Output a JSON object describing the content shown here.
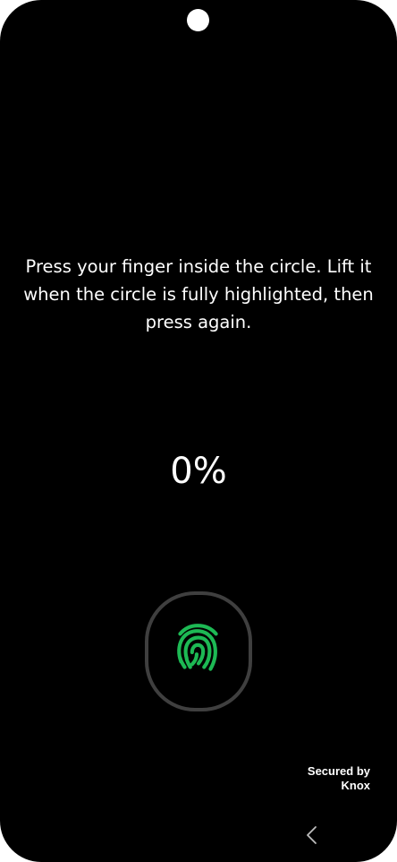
{
  "instructions": {
    "text": "Press your finger inside the circle. Lift it when the circle is fully highlighted, then press again."
  },
  "progress": {
    "value": 0,
    "label": "0%"
  },
  "sensor": {
    "icon": "fingerprint-icon",
    "icon_color": "#1db954",
    "ring_color": "#3f3f3f"
  },
  "footer": {
    "secured_line1": "Secured by",
    "secured_line2": "Knox"
  },
  "nav": {
    "back_icon": "chevron-left-icon"
  }
}
